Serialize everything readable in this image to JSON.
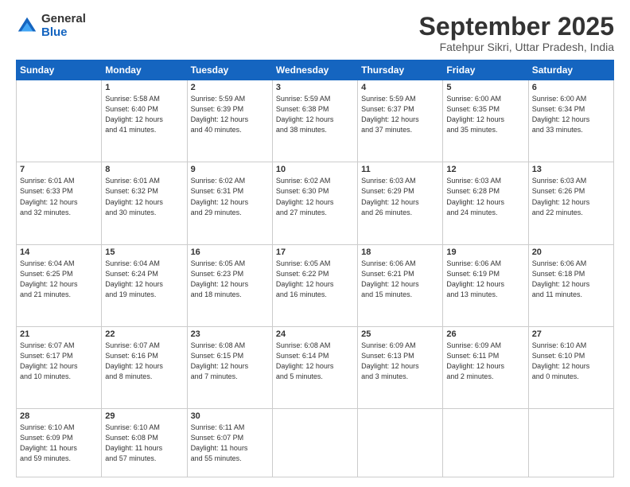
{
  "logo": {
    "general": "General",
    "blue": "Blue"
  },
  "title": "September 2025",
  "location": "Fatehpur Sikri, Uttar Pradesh, India",
  "days_of_week": [
    "Sunday",
    "Monday",
    "Tuesday",
    "Wednesday",
    "Thursday",
    "Friday",
    "Saturday"
  ],
  "weeks": [
    [
      {
        "day": "",
        "info": ""
      },
      {
        "day": "1",
        "info": "Sunrise: 5:58 AM\nSunset: 6:40 PM\nDaylight: 12 hours\nand 41 minutes."
      },
      {
        "day": "2",
        "info": "Sunrise: 5:59 AM\nSunset: 6:39 PM\nDaylight: 12 hours\nand 40 minutes."
      },
      {
        "day": "3",
        "info": "Sunrise: 5:59 AM\nSunset: 6:38 PM\nDaylight: 12 hours\nand 38 minutes."
      },
      {
        "day": "4",
        "info": "Sunrise: 5:59 AM\nSunset: 6:37 PM\nDaylight: 12 hours\nand 37 minutes."
      },
      {
        "day": "5",
        "info": "Sunrise: 6:00 AM\nSunset: 6:35 PM\nDaylight: 12 hours\nand 35 minutes."
      },
      {
        "day": "6",
        "info": "Sunrise: 6:00 AM\nSunset: 6:34 PM\nDaylight: 12 hours\nand 33 minutes."
      }
    ],
    [
      {
        "day": "7",
        "info": "Sunrise: 6:01 AM\nSunset: 6:33 PM\nDaylight: 12 hours\nand 32 minutes."
      },
      {
        "day": "8",
        "info": "Sunrise: 6:01 AM\nSunset: 6:32 PM\nDaylight: 12 hours\nand 30 minutes."
      },
      {
        "day": "9",
        "info": "Sunrise: 6:02 AM\nSunset: 6:31 PM\nDaylight: 12 hours\nand 29 minutes."
      },
      {
        "day": "10",
        "info": "Sunrise: 6:02 AM\nSunset: 6:30 PM\nDaylight: 12 hours\nand 27 minutes."
      },
      {
        "day": "11",
        "info": "Sunrise: 6:03 AM\nSunset: 6:29 PM\nDaylight: 12 hours\nand 26 minutes."
      },
      {
        "day": "12",
        "info": "Sunrise: 6:03 AM\nSunset: 6:28 PM\nDaylight: 12 hours\nand 24 minutes."
      },
      {
        "day": "13",
        "info": "Sunrise: 6:03 AM\nSunset: 6:26 PM\nDaylight: 12 hours\nand 22 minutes."
      }
    ],
    [
      {
        "day": "14",
        "info": "Sunrise: 6:04 AM\nSunset: 6:25 PM\nDaylight: 12 hours\nand 21 minutes."
      },
      {
        "day": "15",
        "info": "Sunrise: 6:04 AM\nSunset: 6:24 PM\nDaylight: 12 hours\nand 19 minutes."
      },
      {
        "day": "16",
        "info": "Sunrise: 6:05 AM\nSunset: 6:23 PM\nDaylight: 12 hours\nand 18 minutes."
      },
      {
        "day": "17",
        "info": "Sunrise: 6:05 AM\nSunset: 6:22 PM\nDaylight: 12 hours\nand 16 minutes."
      },
      {
        "day": "18",
        "info": "Sunrise: 6:06 AM\nSunset: 6:21 PM\nDaylight: 12 hours\nand 15 minutes."
      },
      {
        "day": "19",
        "info": "Sunrise: 6:06 AM\nSunset: 6:19 PM\nDaylight: 12 hours\nand 13 minutes."
      },
      {
        "day": "20",
        "info": "Sunrise: 6:06 AM\nSunset: 6:18 PM\nDaylight: 12 hours\nand 11 minutes."
      }
    ],
    [
      {
        "day": "21",
        "info": "Sunrise: 6:07 AM\nSunset: 6:17 PM\nDaylight: 12 hours\nand 10 minutes."
      },
      {
        "day": "22",
        "info": "Sunrise: 6:07 AM\nSunset: 6:16 PM\nDaylight: 12 hours\nand 8 minutes."
      },
      {
        "day": "23",
        "info": "Sunrise: 6:08 AM\nSunset: 6:15 PM\nDaylight: 12 hours\nand 7 minutes."
      },
      {
        "day": "24",
        "info": "Sunrise: 6:08 AM\nSunset: 6:14 PM\nDaylight: 12 hours\nand 5 minutes."
      },
      {
        "day": "25",
        "info": "Sunrise: 6:09 AM\nSunset: 6:13 PM\nDaylight: 12 hours\nand 3 minutes."
      },
      {
        "day": "26",
        "info": "Sunrise: 6:09 AM\nSunset: 6:11 PM\nDaylight: 12 hours\nand 2 minutes."
      },
      {
        "day": "27",
        "info": "Sunrise: 6:10 AM\nSunset: 6:10 PM\nDaylight: 12 hours\nand 0 minutes."
      }
    ],
    [
      {
        "day": "28",
        "info": "Sunrise: 6:10 AM\nSunset: 6:09 PM\nDaylight: 11 hours\nand 59 minutes."
      },
      {
        "day": "29",
        "info": "Sunrise: 6:10 AM\nSunset: 6:08 PM\nDaylight: 11 hours\nand 57 minutes."
      },
      {
        "day": "30",
        "info": "Sunrise: 6:11 AM\nSunset: 6:07 PM\nDaylight: 11 hours\nand 55 minutes."
      },
      {
        "day": "",
        "info": ""
      },
      {
        "day": "",
        "info": ""
      },
      {
        "day": "",
        "info": ""
      },
      {
        "day": "",
        "info": ""
      }
    ]
  ]
}
